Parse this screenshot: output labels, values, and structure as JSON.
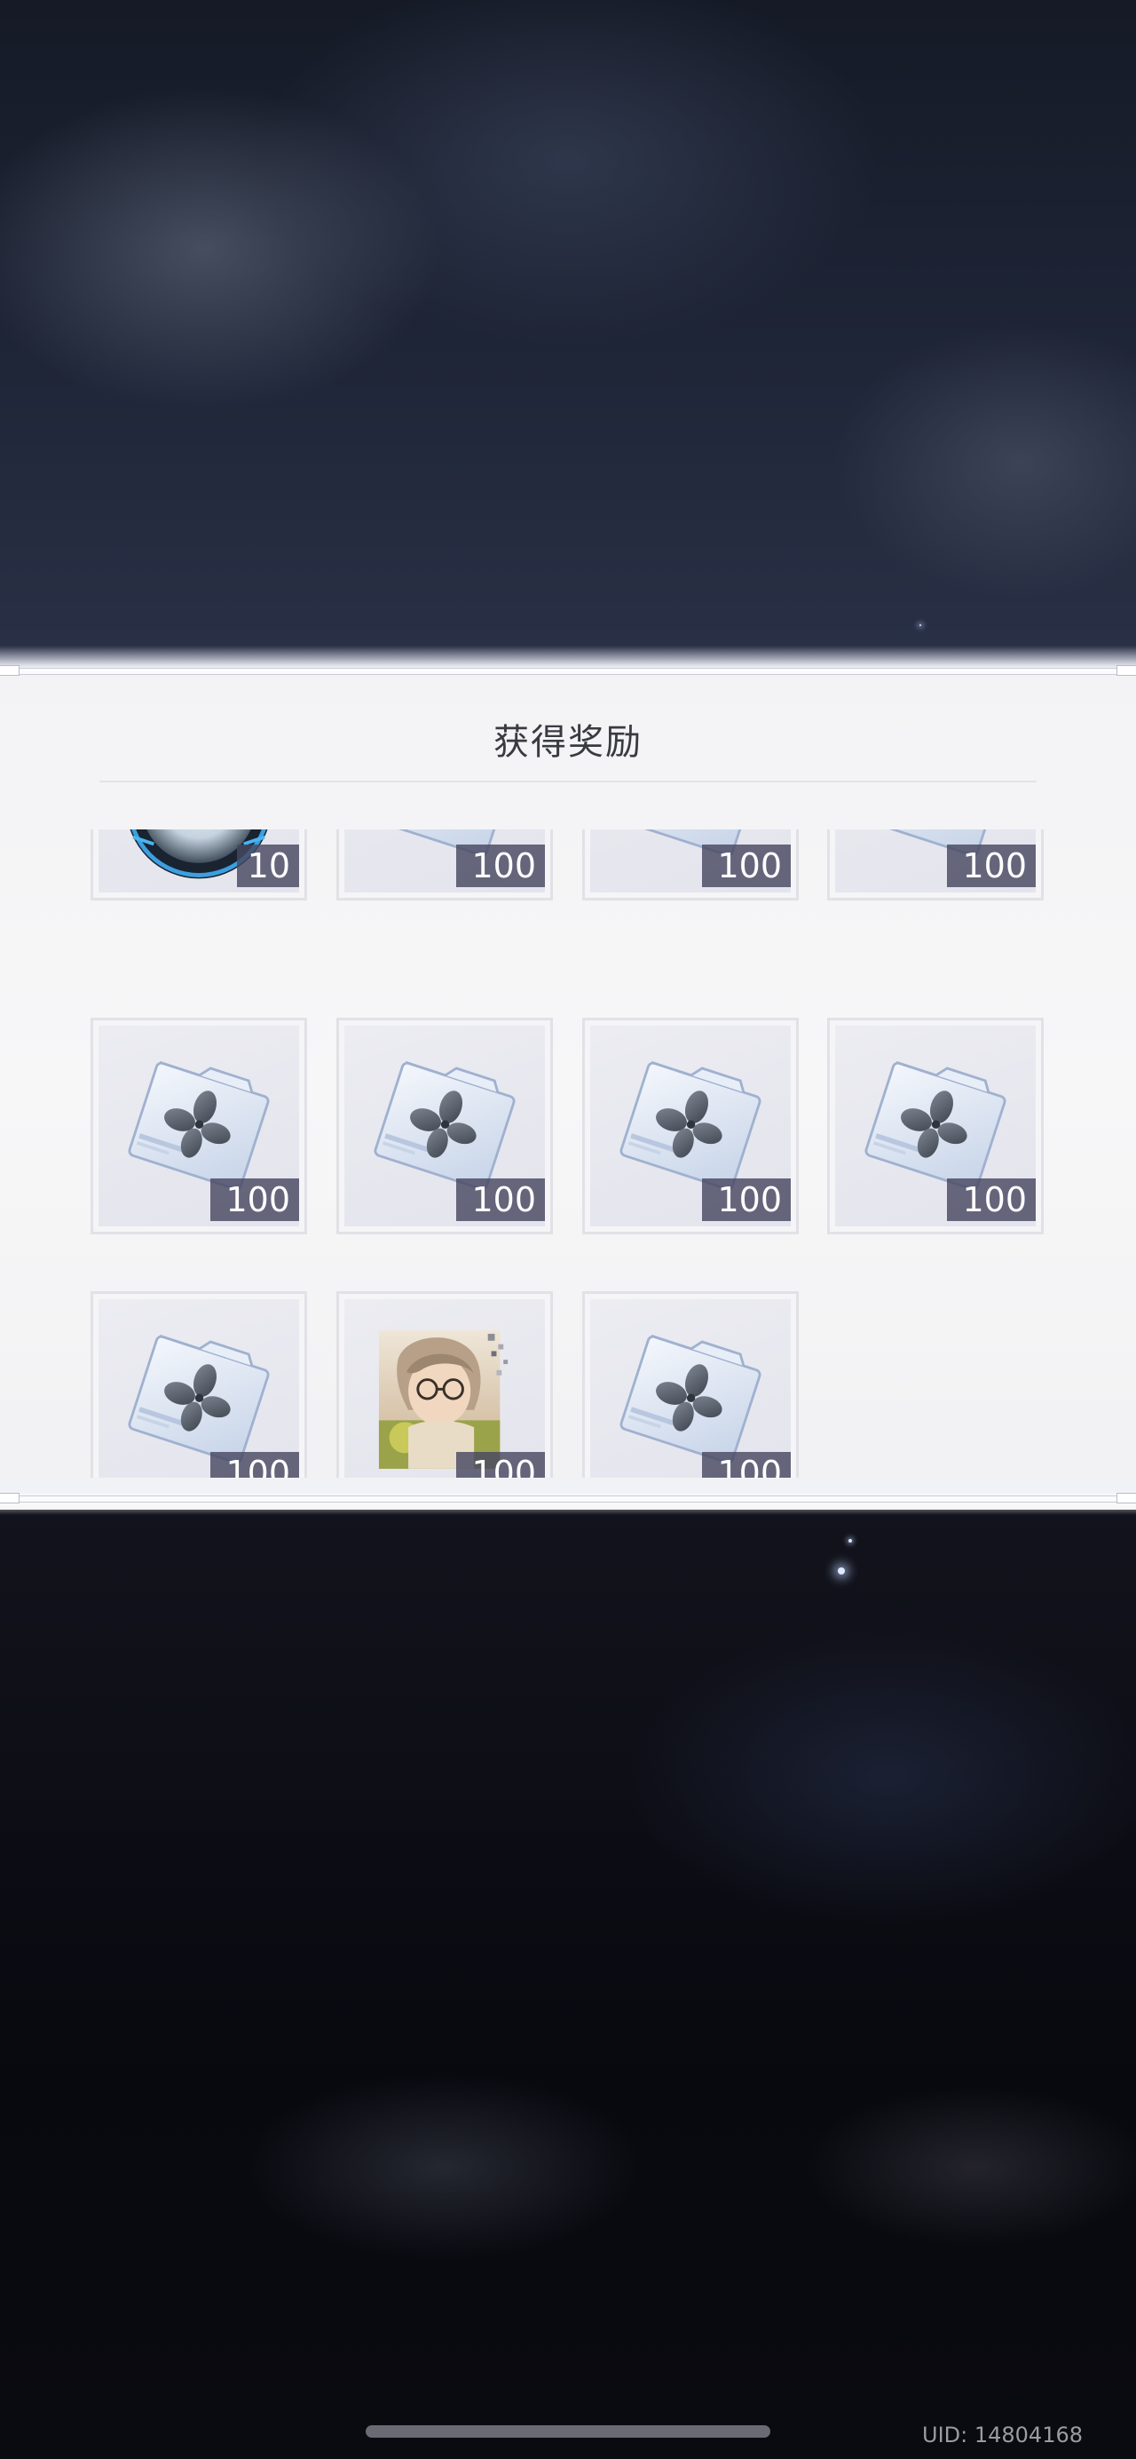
{
  "dialog": {
    "title": "获得奖励"
  },
  "rewards": [
    {
      "icon": "badge-medal-icon",
      "quantity": "10"
    },
    {
      "icon": "data-folder-icon",
      "quantity": "100"
    },
    {
      "icon": "data-folder-icon",
      "quantity": "100"
    },
    {
      "icon": "data-folder-icon",
      "quantity": "100"
    },
    {
      "icon": "data-folder-icon",
      "quantity": "100"
    },
    {
      "icon": "data-folder-icon",
      "quantity": "100"
    },
    {
      "icon": "data-folder-icon",
      "quantity": "100"
    },
    {
      "icon": "data-folder-icon",
      "quantity": "100"
    },
    {
      "icon": "data-folder-icon",
      "quantity": "100"
    },
    {
      "icon": "character-portrait-icon",
      "quantity": "100"
    },
    {
      "icon": "data-folder-icon",
      "quantity": "100"
    }
  ],
  "footer": {
    "uid": "UID: 14804168"
  },
  "colors": {
    "panel_bg": "#f5f5f7",
    "quantity_badge": "#484862",
    "title_text": "#3a3a42"
  }
}
